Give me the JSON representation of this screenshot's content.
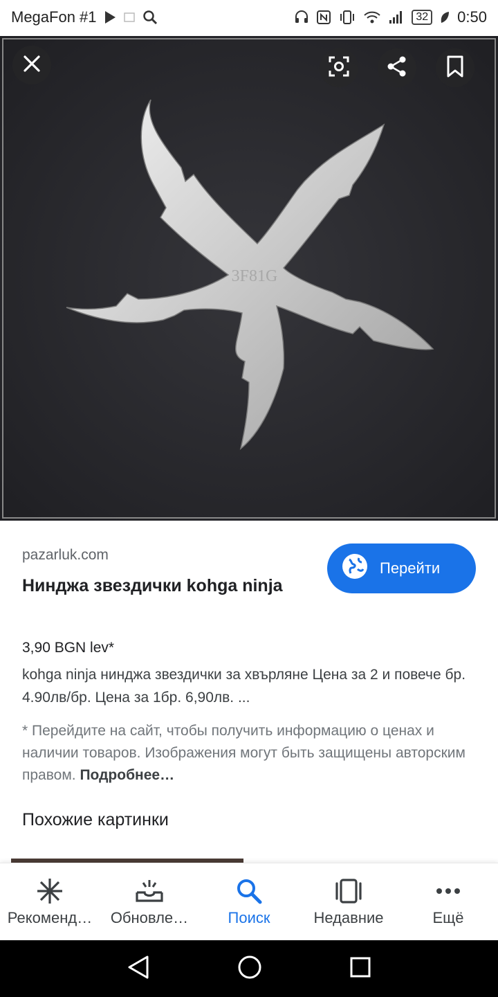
{
  "status_bar": {
    "carrier": "MegaFon #1",
    "battery": "32",
    "time": "0:50"
  },
  "viewer": {
    "engraving": "3F81G",
    "close_icon": "close-icon",
    "lens_icon": "lens-icon",
    "share_icon": "share-icon",
    "bookmark_icon": "bookmark-icon"
  },
  "result": {
    "domain": "pazarluk.com",
    "title": "Нинджа звездички kohga ninja",
    "go_label": "Перейти",
    "price": "3,90 BGN lev*",
    "description": "kohga ninja нинджа звездички за хвърляне Цена за 2 и повече бр. 4.90лв/бр. Цена за 1бр. 6,90лв. ...",
    "note": "* Перейдите на сайт, чтобы получить информацию о ценах и наличии товаров. Изображения могут быть защищены авторским правом.",
    "note_more": "Подробнее…",
    "similar_heading": "Похожие картинки"
  },
  "bottom_nav": {
    "items": [
      {
        "label": "Рекоменд…",
        "icon": "asterisk-icon"
      },
      {
        "label": "Обновле…",
        "icon": "inbox-icon"
      },
      {
        "label": "Поиск",
        "icon": "search-icon"
      },
      {
        "label": "Недавние",
        "icon": "recent-icon"
      },
      {
        "label": "Ещё",
        "icon": "more-icon"
      }
    ]
  },
  "colors": {
    "accent": "#1a73e8",
    "viewer_bg": "#2a2a2e"
  }
}
